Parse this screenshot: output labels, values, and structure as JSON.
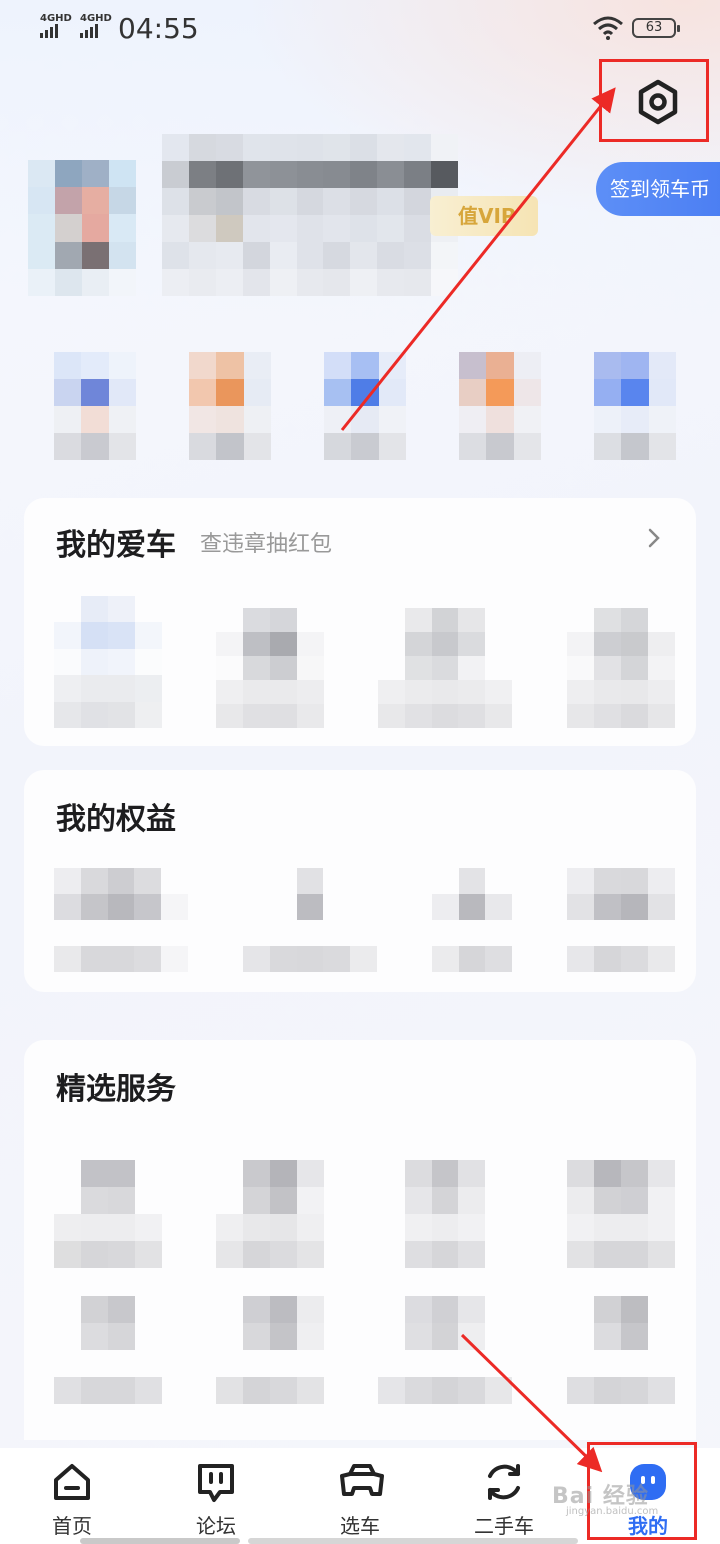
{
  "status": {
    "signal1": "4GHD",
    "signal2": "4GHD",
    "time": "04:55",
    "battery": "63"
  },
  "header": {
    "settings_icon": "gear-icon",
    "checkin_label": "签到领车币",
    "vip_label": "值VIP"
  },
  "my_car": {
    "title": "我的爱车",
    "subtitle": "查违章抽红包"
  },
  "my_benefits": {
    "title": "我的权益"
  },
  "services": {
    "title": "精选服务"
  },
  "nav": {
    "items": [
      {
        "label": "首页",
        "icon": "home-icon"
      },
      {
        "label": "论坛",
        "icon": "forum-icon"
      },
      {
        "label": "选车",
        "icon": "car-select-icon"
      },
      {
        "label": "二手车",
        "icon": "used-car-icon"
      },
      {
        "label": "我的",
        "icon": "profile-icon"
      }
    ],
    "active_index": 4,
    "accent": "#2f6df3"
  },
  "annotation_color": "#ec2a26",
  "watermark": {
    "text": "Bai 经验",
    "sub": "jingyan.baidu.com"
  }
}
